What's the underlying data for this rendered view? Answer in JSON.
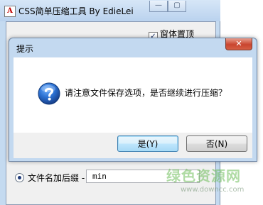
{
  "main_window": {
    "title": "CSS简单压缩工具 By EdieLei",
    "app_icon_glyph": "A",
    "minimize_glyph": "—",
    "maximize_glyph": "▢",
    "topmost_checkbox": {
      "label": "窗体置顶",
      "checked": true,
      "check_glyph": "✓"
    },
    "suffix_option": {
      "label": "文件名加后缀 -",
      "selected": true,
      "value": "min"
    }
  },
  "dialog": {
    "title": "提示",
    "close_glyph": "✕",
    "icon": "question-icon",
    "message": "请注意文件保存选项，是否继续进行压缩？",
    "yes_label": "是(Y)",
    "no_label": "否(N)"
  },
  "watermark": {
    "brand": "绿色资源网",
    "url": "www.downcc.com"
  },
  "colors": {
    "window_frame": "#c4daf0",
    "close_button": "#c9452f",
    "default_button_border": "#3c7fb1",
    "question_icon": "#1f5fb4",
    "watermark": "#6ebe5a"
  }
}
